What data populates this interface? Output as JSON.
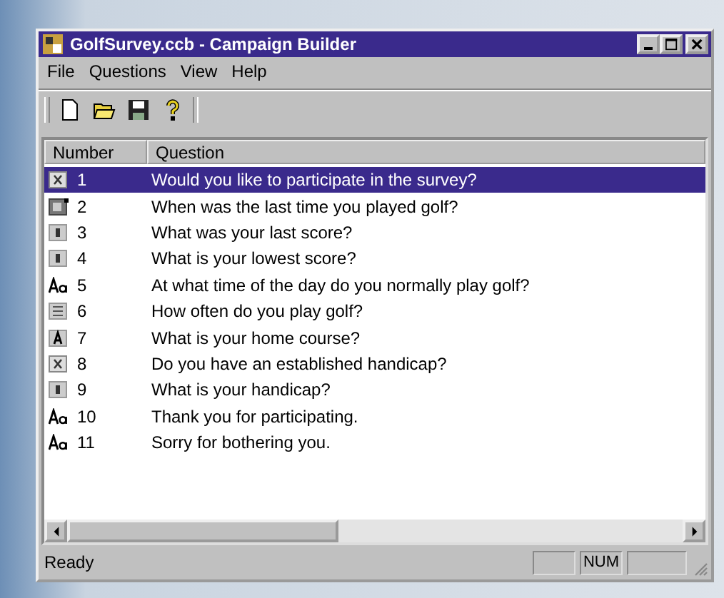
{
  "window": {
    "title": "GolfSurvey.ccb - Campaign Builder"
  },
  "menu": [
    {
      "label": "File"
    },
    {
      "label": "Questions"
    },
    {
      "label": "View"
    },
    {
      "label": "Help"
    }
  ],
  "toolbar": [
    {
      "kind": "new"
    },
    {
      "kind": "open"
    },
    {
      "kind": "save"
    },
    {
      "kind": "help"
    }
  ],
  "table": {
    "columns": [
      "Number",
      "Question"
    ],
    "rows": [
      {
        "kind": "yesno",
        "number": "1",
        "question": "Would you like to participate in the survey?",
        "selected": true
      },
      {
        "kind": "date",
        "number": "2",
        "question": "When was the last time you played golf?",
        "selected": false
      },
      {
        "kind": "numeric",
        "number": "3",
        "question": "What was your last score?",
        "selected": false
      },
      {
        "kind": "numeric",
        "number": "4",
        "question": "What is your lowest score?",
        "selected": false
      },
      {
        "kind": "statement",
        "number": "5",
        "question": "At what time of the day do you normally play golf?",
        "selected": false
      },
      {
        "kind": "choice",
        "number": "6",
        "question": "How often do you play golf?",
        "selected": false
      },
      {
        "kind": "alpha",
        "number": "7",
        "question": "What is your home course?",
        "selected": false
      },
      {
        "kind": "yesno",
        "number": "8",
        "question": "Do you have an established handicap?",
        "selected": false
      },
      {
        "kind": "numeric",
        "number": "9",
        "question": "What is your handicap?",
        "selected": false
      },
      {
        "kind": "statement",
        "number": "10",
        "question": "Thank you for participating.",
        "selected": false
      },
      {
        "kind": "statement",
        "number": "11",
        "question": "Sorry for bothering you.",
        "selected": false
      }
    ]
  },
  "status_bar": {
    "text": "Ready",
    "indicator": "NUM"
  }
}
